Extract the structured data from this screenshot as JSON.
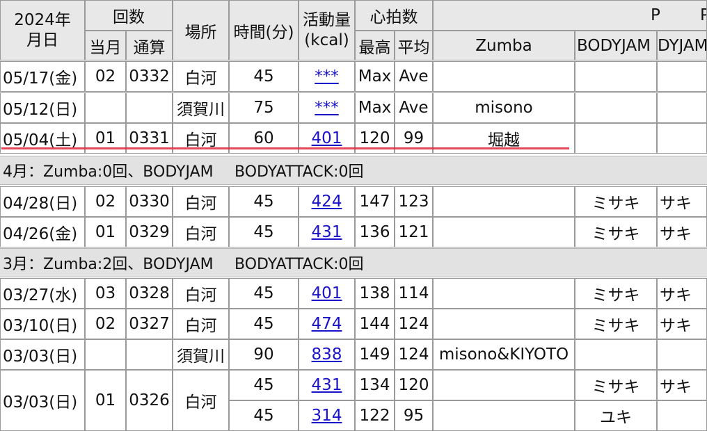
{
  "header": {
    "year_date": "2024年\n月日",
    "count": "回数",
    "count_month": "当月",
    "count_total": "通算",
    "place": "場所",
    "time": "時間(分)",
    "activity": "活動量\n(kcal)",
    "heart": "心拍数",
    "heart_max": "最高",
    "heart_avg": "平均",
    "zumba": "Zumba",
    "bodyjam": "BODYJAM",
    "bodyattack": "DYJAM",
    "trunc1": "P",
    "trunc2": "P"
  },
  "rows": [
    {
      "date": "05/17(金)",
      "month": "02",
      "total": "0332",
      "place": "白河",
      "time": "45",
      "kcal": "***",
      "max": "Max",
      "avg": "Ave",
      "zumba": "",
      "bj": "",
      "ba": ""
    },
    {
      "date": "05/12(日)",
      "month": "",
      "total": "",
      "place": "須賀川",
      "time": "75",
      "kcal": "***",
      "max": "Max",
      "avg": "Ave",
      "zumba": "misono",
      "bj": "",
      "ba": ""
    },
    {
      "date": "05/04(土)",
      "month": "01",
      "total": "0331",
      "place": "白河",
      "time": "60",
      "kcal": "401",
      "max": "120",
      "avg": "99",
      "zumba": "堀越",
      "bj": "",
      "ba": ""
    },
    {
      "date": "04/28(日)",
      "month": "02",
      "total": "0330",
      "place": "白河",
      "time": "45",
      "kcal": "424",
      "max": "147",
      "avg": "123",
      "zumba": "",
      "bj": "ミサキ",
      "ba": "サキ"
    },
    {
      "date": "04/26(金)",
      "month": "01",
      "total": "0329",
      "place": "白河",
      "time": "45",
      "kcal": "431",
      "max": "136",
      "avg": "121",
      "zumba": "",
      "bj": "ミサキ",
      "ba": "サキ"
    },
    {
      "date": "03/27(水)",
      "month": "03",
      "total": "0328",
      "place": "白河",
      "time": "45",
      "kcal": "401",
      "max": "138",
      "avg": "114",
      "zumba": "",
      "bj": "ミサキ",
      "ba": "サキ"
    },
    {
      "date": "03/10(日)",
      "month": "02",
      "total": "0327",
      "place": "白河",
      "time": "45",
      "kcal": "474",
      "max": "144",
      "avg": "124",
      "zumba": "",
      "bj": "ミサキ",
      "ba": "サキ"
    },
    {
      "date": "03/03(日)",
      "month": "",
      "total": "",
      "place": "須賀川",
      "time": "90",
      "kcal": "838",
      "max": "149",
      "avg": "124",
      "zumba": "misono&KIYOTO",
      "bj": "",
      "ba": ""
    },
    {
      "date": "03/03(日)",
      "month": "01",
      "total": "0326",
      "place": "白河",
      "time": "45",
      "kcal": "431",
      "max": "134",
      "avg": "120",
      "zumba": "",
      "bj": "ミサキ",
      "ba": "サキ"
    },
    {
      "date": "",
      "month": "",
      "total": "",
      "place": "",
      "time": "45",
      "kcal": "314",
      "max": "122",
      "avg": "95",
      "zumba": "",
      "bj": "ユキ",
      "ba": ""
    }
  ],
  "summaries": {
    "april": "4月：Zumba:0回、BODYJAM",
    "april_b": "BODYATTACK:0回",
    "march": "3月：Zumba:2回、BODYJAM",
    "march_b": "BODYATTACK:0回"
  }
}
